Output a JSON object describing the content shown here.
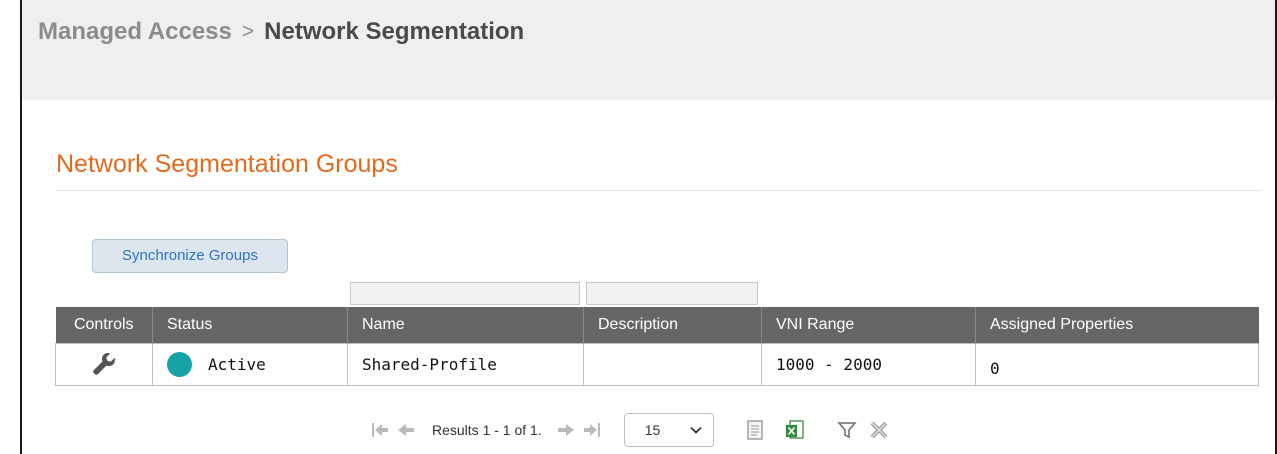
{
  "breadcrumb": {
    "parent": "Managed Access",
    "separator": ">",
    "current": "Network Segmentation"
  },
  "section": {
    "title": "Network Segmentation Groups"
  },
  "toolbar": {
    "sync_label": "Synchronize Groups"
  },
  "table": {
    "columns": [
      "Controls",
      "Status",
      "Name",
      "Description",
      "VNI Range",
      "Assigned Properties"
    ],
    "rows": [
      {
        "controls_icon": "wrench-icon",
        "status": "Active",
        "status_color": "#17a2a8",
        "name": "Shared-Profile",
        "description": "",
        "vni_range": "1000 - 2000",
        "assigned_properties": "0"
      }
    ]
  },
  "pager": {
    "results_text": "Results 1 - 1 of 1.",
    "page_size": "15",
    "icons": [
      "first-page-icon",
      "prev-page-icon",
      "next-page-icon",
      "last-page-icon",
      "chevron-down-icon",
      "export-text-icon",
      "export-excel-icon",
      "filter-icon",
      "clear-filter-icon"
    ]
  },
  "colors": {
    "accent_title": "#e26a1c",
    "header_bg": "#666666",
    "sync_button_text": "#2f73c7"
  }
}
